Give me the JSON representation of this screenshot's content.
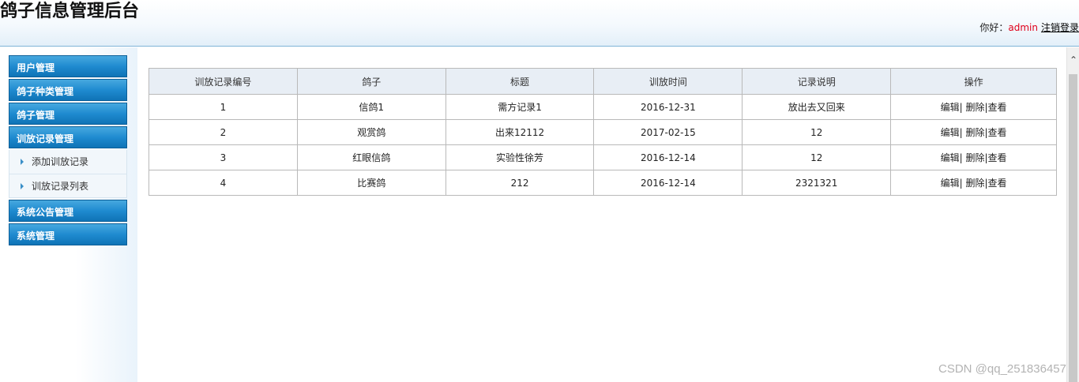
{
  "header": {
    "title": "鸽子信息管理后台",
    "greeting": "你好：",
    "username": "admin",
    "logout": "注销登录"
  },
  "sidebar": {
    "menus": [
      {
        "label": "用户管理"
      },
      {
        "label": "鸽子种类管理"
      },
      {
        "label": "鸽子管理"
      },
      {
        "label": "训放记录管理",
        "items": [
          {
            "label": "添加训放记录"
          },
          {
            "label": "训放记录列表"
          }
        ]
      },
      {
        "label": "系统公告管理"
      },
      {
        "label": "系统管理"
      }
    ]
  },
  "table": {
    "headers": [
      "训放记录编号",
      "鸽子",
      "标题",
      "训放时间",
      "记录说明",
      "操作"
    ],
    "rows": [
      {
        "id": "1",
        "pigeon": "信鸽1",
        "title": "需方记录1",
        "time": "2016-12-31",
        "note": "放出去又回来"
      },
      {
        "id": "2",
        "pigeon": "观赏鸽",
        "title": "出来12112",
        "time": "2017-02-15",
        "note": "12"
      },
      {
        "id": "3",
        "pigeon": "红眼信鸽",
        "title": "实验性徐芳",
        "time": "2016-12-14",
        "note": "12"
      },
      {
        "id": "4",
        "pigeon": "比赛鸽",
        "title": "212",
        "time": "2016-12-14",
        "note": "2321321"
      }
    ],
    "actions": {
      "edit": "编辑|",
      "delete": "删除",
      "sep": "|",
      "view": "查看"
    }
  },
  "scrollbar": {
    "up_glyph": "⌃"
  },
  "watermark": "CSDN @qq_251836457"
}
